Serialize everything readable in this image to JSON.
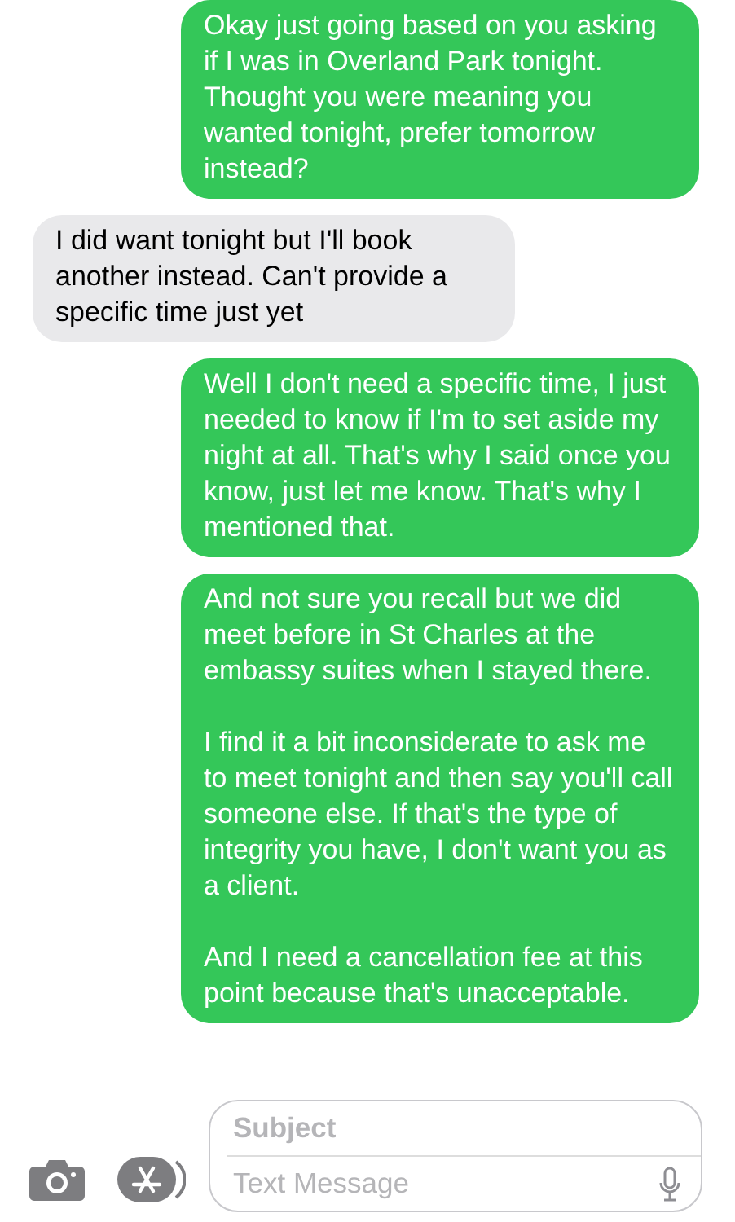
{
  "messages": [
    {
      "kind": "sent",
      "paragraphs": [
        "Okay just going based on you asking if I was in Overland Park tonight. Thought you were meaning you wanted tonight, prefer tomorrow instead?"
      ]
    },
    {
      "kind": "received",
      "paragraphs": [
        "I did want tonight but I'll book another instead. Can't provide a specific time just yet"
      ]
    },
    {
      "kind": "sent",
      "paragraphs": [
        "Well I don't need a specific time, I just needed to know if I'm to set aside my night at all. That's why I said once you know, just let me know. That's why I mentioned that."
      ]
    },
    {
      "kind": "sent",
      "paragraphs": [
        "And not sure you recall but we did meet before in St Charles at the embassy suites when I stayed there.",
        "I find it a bit inconsiderate to ask me to meet tonight and then say you'll call someone else. If that's the type of integrity you have, I don't want you as a client.",
        "And I need a cancellation fee at this point because that's unacceptable."
      ]
    }
  ],
  "composer": {
    "subject": {
      "placeholder": "Subject"
    },
    "message": {
      "placeholder": "Text Message"
    }
  }
}
